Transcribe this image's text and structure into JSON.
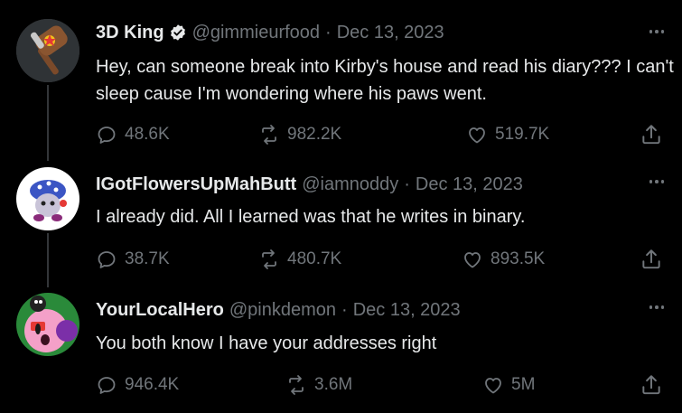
{
  "tweets": [
    {
      "display_name": "3D King",
      "handle": "@gimmieurfood",
      "separator": "·",
      "date": "Dec 13, 2023",
      "verified": true,
      "text": "Hey, can someone break into Kirby's house and read his diary??? I can't sleep cause I'm wondering where his paws went.",
      "replies": "48.6K",
      "retweets": "982.2K",
      "likes": "519.7K",
      "avatar_icon": "hammer-avatar"
    },
    {
      "display_name": "IGotFlowersUpMahButt",
      "handle": "@iamnoddy",
      "separator": "·",
      "date": "Dec 13, 2023",
      "verified": false,
      "text": "I already did. All I learned was that he writes in binary.",
      "replies": "38.7K",
      "retweets": "480.7K",
      "likes": "893.5K",
      "avatar_icon": "character-avatar"
    },
    {
      "display_name": "YourLocalHero",
      "handle": "@pinkdemon",
      "separator": "·",
      "date": "Dec 13, 2023",
      "verified": false,
      "text": "You both know I have your addresses right",
      "replies": "946.4K",
      "retweets": "3.6M",
      "likes": "5M",
      "avatar_icon": "pink-hero-avatar"
    }
  ],
  "colors": {
    "background": "#000000",
    "primary_text": "#e7e9ea",
    "secondary_text": "#71767b",
    "thread_line": "#333639"
  }
}
